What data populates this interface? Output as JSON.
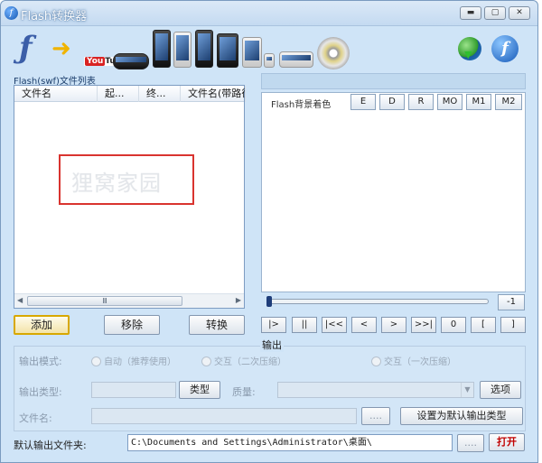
{
  "window": {
    "title": "Flash转换器",
    "controls": {
      "minimize": "▬",
      "maximize": "▢",
      "close": "✕"
    }
  },
  "banner": {
    "youtube_prefix": "You",
    "youtube_suffix": "Tube"
  },
  "file_list": {
    "label": "Flash(swf)文件列表",
    "columns": [
      "文件名",
      "起...",
      "终...",
      "文件名(带路径)"
    ],
    "rows": [],
    "watermark": "狸窝家园",
    "scroll_thumb": "Ⅲ"
  },
  "preview": {
    "background_label": "Flash背景着色",
    "keys": [
      "E",
      "D",
      "R",
      "MO",
      "M1",
      "M2"
    ],
    "speed_value": "-1",
    "slider_position": 0
  },
  "actions": {
    "add": "添加",
    "remove": "移除",
    "convert": "转换"
  },
  "playback": [
    "|>",
    "||",
    "|<<",
    "<",
    ">",
    ">>|",
    "0",
    "[",
    "]"
  ],
  "output": {
    "title": "输出",
    "mode_label": "输出模式:",
    "mode_options": [
      "自动（推荐使用）",
      "交互（二次压缩）",
      "交互（一次压缩）"
    ],
    "type_label": "输出类型:",
    "type_button": "类型",
    "quality_label": "质量:",
    "options_button": "选项",
    "filename_label": "文件名:",
    "browse_button": "....",
    "set_default_button": "设置为默认输出类型"
  },
  "default_folder": {
    "label": "默认输出文件夹:",
    "path": "C:\\Documents and Settings\\Administrator\\桌面\\",
    "browse_button": "....",
    "open_button": "打开"
  },
  "colors": {
    "window_bg": "#cfe4f7",
    "accent_border": "#d8a800",
    "watermark_border": "#d9342f",
    "open_text": "#c00000"
  }
}
